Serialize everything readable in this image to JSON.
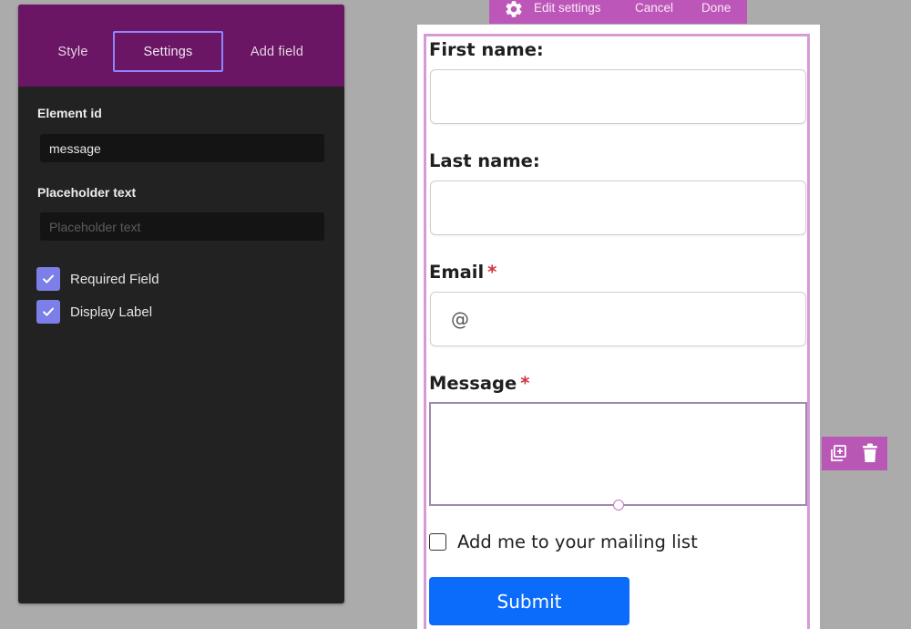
{
  "settings_panel": {
    "tabs": [
      {
        "label": "Style"
      },
      {
        "label": "Settings",
        "active": true
      },
      {
        "label": "Add field"
      }
    ],
    "element_id": {
      "label": "Element id",
      "value": "message"
    },
    "placeholder": {
      "label": "Placeholder text",
      "value": "",
      "placeholder": "Placeholder text"
    },
    "checkboxes": [
      {
        "label": "Required Field",
        "checked": true
      },
      {
        "label": "Display Label",
        "checked": true
      }
    ]
  },
  "toolbar": {
    "gear_icon": "gear-icon",
    "edit_label": "Edit settings",
    "cancel_label": "Cancel",
    "done_label": "Done"
  },
  "form": {
    "fields": [
      {
        "label": "First name:",
        "required": false
      },
      {
        "label": "Last name:",
        "required": false
      },
      {
        "label": "Email",
        "required": true,
        "prefix": "@"
      },
      {
        "label": "Message",
        "required": true
      }
    ],
    "required_marker": "*",
    "mailing_list": {
      "label": "Add me to your mailing list",
      "checked": false
    },
    "submit_label": "Submit"
  },
  "colors": {
    "panel_bg": "#222222",
    "tab_bar_bg": "#6b1565",
    "checkbox_accent": "#7b7fe7",
    "toolbar_bg": "#bd56b9",
    "submit_bg": "#0b6cfb",
    "required_star": "#d2343b"
  }
}
